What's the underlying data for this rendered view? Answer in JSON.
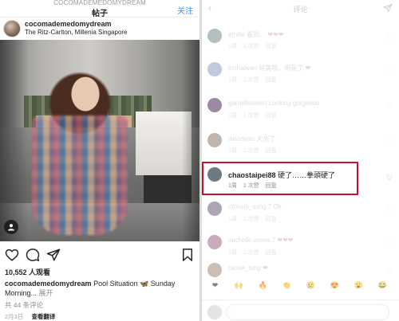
{
  "left": {
    "top_username": "COCOMADEMEDOMYDREAM",
    "title": "帖子",
    "follow_label": "关注",
    "post": {
      "username": "cocomademedomydream",
      "location": "The Ritz-Carlton, Millenia Singapore",
      "likes": "10,552 人观看",
      "caption_user": "cocomademedomydream",
      "caption_text": "Pool Situation 🦋 Sunday Morning... ",
      "caption_more": "展开",
      "comments_count": "共 44 条评论",
      "date": "2月3日",
      "translate": "查看翻译"
    },
    "icons": [
      "heart-icon",
      "comment-icon",
      "share-icon",
      "bookmark-icon",
      "user-tag-icon"
    ]
  },
  "right": {
    "title": "评论",
    "comments": [
      {
        "user": "emilie",
        "text": "看到…  ",
        "hearts": "❤❤❤",
        "meta": [
          "1周",
          "1 次赞",
          "回复"
        ],
        "avatar_color": "#7a8a8f"
      },
      {
        "user": "lorihaiwan",
        "text": "好美哦，啊是了 ",
        "hearts": "❤",
        "meta": [
          "1周",
          "1 次赞",
          "回复"
        ],
        "avatar_color": "#8aa1c0"
      },
      {
        "user": "garrettieuwen",
        "text": "Looking gorgeous",
        "hearts": "",
        "meta": [
          "1周",
          "1 次赞",
          "回复"
        ],
        "avatar_color": "#4a2a5a"
      },
      {
        "user": "davidwsu",
        "text": "天光了",
        "hearts": "",
        "meta": [
          "1周",
          "1 次赞",
          "回复"
        ],
        "avatar_color": "#8e7a6a"
      },
      {
        "user": "chaostaipei88",
        "text": "硬了……拳頭硬了",
        "hearts": "",
        "meta": [
          "1周",
          "1 次赞",
          "回复"
        ],
        "avatar_color": "#6a7b86"
      },
      {
        "user": "mohsin_sung.7",
        "text": "Ok",
        "hearts": "",
        "meta": [
          "1周",
          "1 次赞",
          "回复"
        ],
        "avatar_color": "#6b5a7a"
      },
      {
        "user": "michelle.wooie.7",
        "text": "",
        "hearts": "❤❤❤",
        "meta": [
          "1周",
          "1 次赞",
          "回复"
        ],
        "avatar_color": "#9a6a8a"
      },
      {
        "user": "nicole_tang",
        "text": "",
        "hearts": "❤",
        "meta": [],
        "avatar_color": "#a08a7a"
      }
    ],
    "emojis": [
      "❤",
      "🙌",
      "🔥",
      "👏",
      "😢",
      "😍",
      "😮",
      "😂"
    ]
  },
  "colors": {
    "accent": "#3897f0",
    "highlight": "#c8102e"
  }
}
